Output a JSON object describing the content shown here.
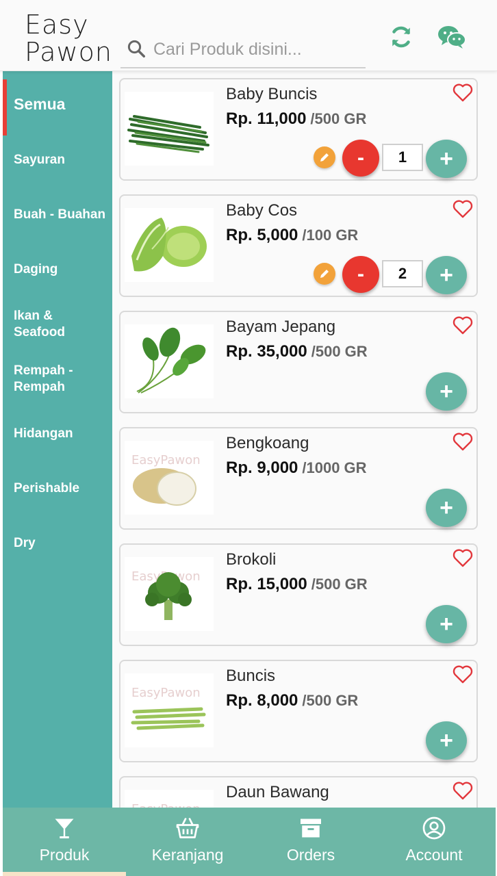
{
  "header": {
    "logo_line1": "Easy",
    "logo_line2": "Pawon",
    "search_placeholder": "Cari Produk disini...",
    "icons": [
      "search-icon",
      "refresh-icon",
      "wechat-icon"
    ]
  },
  "sidebar": {
    "items": [
      {
        "label": "Semua",
        "active": true
      },
      {
        "label": "Sayuran"
      },
      {
        "label": "Buah - Buahan"
      },
      {
        "label": "Daging"
      },
      {
        "label": "Ikan & Seafood"
      },
      {
        "label": "Rempah - Rempah"
      },
      {
        "label": "Hidangan"
      },
      {
        "label": "Perishable"
      },
      {
        "label": "Dry"
      }
    ]
  },
  "products": [
    {
      "name": "Baby Buncis",
      "price": "Rp. 11,000",
      "unit": "/500 GR",
      "qty": "1",
      "in_cart": true
    },
    {
      "name": "Baby Cos",
      "price": "Rp. 5,000",
      "unit": "/100 GR",
      "qty": "2",
      "in_cart": true
    },
    {
      "name": "Bayam Jepang",
      "price": "Rp. 35,000",
      "unit": "/500 GR",
      "in_cart": false
    },
    {
      "name": "Bengkoang",
      "price": "Rp. 9,000",
      "unit": "/1000 GR",
      "in_cart": false,
      "watermark": "EasyPawon"
    },
    {
      "name": "Brokoli",
      "price": "Rp. 15,000",
      "unit": "/500 GR",
      "in_cart": false,
      "watermark": "EasyPawon"
    },
    {
      "name": "Buncis",
      "price": "Rp. 8,000",
      "unit": "/500 GR",
      "in_cart": false,
      "watermark": "EasyPawon"
    },
    {
      "name": "Daun Bawang",
      "price": "",
      "unit": "",
      "in_cart": false,
      "watermark": "EasyPawon"
    }
  ],
  "buttons": {
    "minus": "-",
    "plus": "+"
  },
  "bottom_nav": [
    {
      "label": "Produk",
      "icon": "cocktail-icon",
      "active": true
    },
    {
      "label": "Keranjang",
      "icon": "basket-icon"
    },
    {
      "label": "Orders",
      "icon": "archive-icon"
    },
    {
      "label": "Account",
      "icon": "user-circle-icon"
    }
  ],
  "colors": {
    "teal": "#55b0a9",
    "nav": "#6db7a6",
    "red": "#e8372f",
    "orange": "#f2a23a",
    "plus": "#67b6a5"
  }
}
